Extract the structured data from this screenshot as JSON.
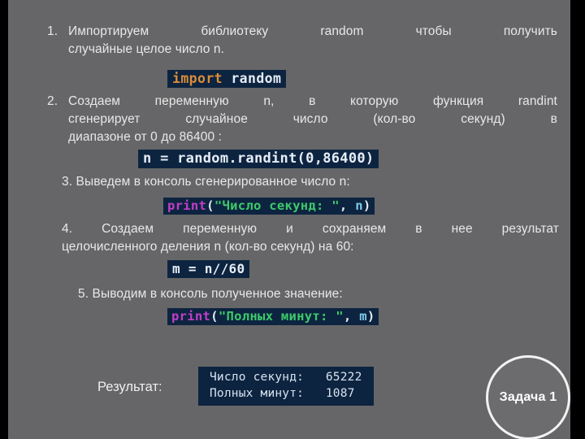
{
  "slide": {
    "background_color": "#666668",
    "edge_bar_color": "#000000",
    "code_background_color": "#0d2440"
  },
  "steps": [
    {
      "number": "1.",
      "line1_words": [
        "Импортируем",
        "библиотеку",
        "random",
        "чтобы",
        "получить"
      ],
      "line2": "случайные целое  число n."
    },
    {
      "number": "2.",
      "line1_words": [
        "Создаем",
        "переменную",
        "n,",
        "в",
        "которую",
        "функция",
        "randint"
      ],
      "line2_words": [
        "сгенерирует",
        "случайное",
        "число",
        "(кол-во",
        "секунд)",
        "в"
      ],
      "line3": "диапазоне от 0 до 86400 :"
    },
    {
      "number": "3.",
      "text": "3. Выведем в консоль сгенерированное число n:"
    },
    {
      "number": "4.",
      "line1_words": [
        "4.",
        "Создаем",
        "переменную",
        "и",
        "сохраняем",
        "в",
        "нее",
        "результат"
      ],
      "line2": "целочисленного деления n (кол-во секунд) на 60:"
    },
    {
      "number": "5.",
      "text": "5.  Выводим в консоль полученное значение:"
    }
  ],
  "code": {
    "import_keyword": "import",
    "import_module": " random",
    "randint_line": "n = random.randint(0,86400)",
    "print1": {
      "fn": "print",
      "open": "(",
      "string": "\"Число секунд: \"",
      "comma": ", ",
      "var": "n",
      "close": ")"
    },
    "m_line": "m = n//60",
    "print2": {
      "fn": "print",
      "open": "(",
      "string": "\"Полных минут: \"",
      "comma": ", ",
      "var": "m",
      "close": ")"
    }
  },
  "result": {
    "label": "Результат:",
    "line1": "Число секунд:   65222",
    "line2": "Полных минут:   1087"
  },
  "badge": {
    "label": "Задача 1"
  }
}
